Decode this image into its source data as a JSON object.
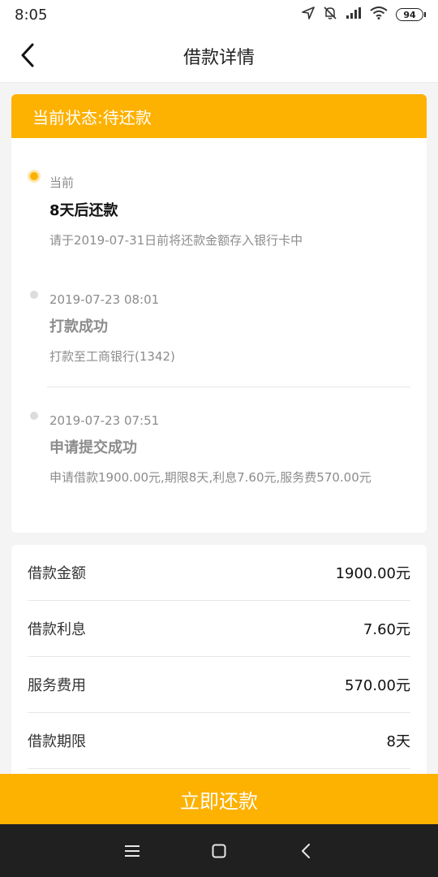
{
  "status_bar": {
    "time": "8:05",
    "battery": "94"
  },
  "header": {
    "title": "借款详情"
  },
  "status_card": {
    "banner": "当前状态:待还款",
    "timeline": [
      {
        "time": "当前",
        "title": "8天后还款",
        "desc": "请于2019-07-31日前将还款金额存入银行卡中",
        "active": true
      },
      {
        "time": "2019-07-23 08:01",
        "title": "打款成功",
        "desc": "打款至工商银行(1342)",
        "active": false
      },
      {
        "time": "2019-07-23 07:51",
        "title": "申请提交成功",
        "desc": "申请借款1900.00元,期限8天,利息7.60元,服务费570.00元",
        "active": false
      }
    ]
  },
  "details": [
    {
      "label": "借款金额",
      "value": "1900.00元"
    },
    {
      "label": "借款利息",
      "value": "7.60元"
    },
    {
      "label": "服务费用",
      "value": "570.00元"
    },
    {
      "label": "借款期限",
      "value": "8天"
    }
  ],
  "actions": {
    "repay_label": "立即还款"
  },
  "colors": {
    "accent": "#fdb100",
    "nav_bg": "#202020"
  },
  "icons": {
    "back": "chevron-left-icon",
    "location": "location-arrow-icon",
    "mute": "bell-off-icon",
    "signal": "signal-icon",
    "wifi": "wifi-icon",
    "battery": "battery-icon",
    "menu": "menu-icon",
    "home": "home-square-icon",
    "nav_back": "nav-back-icon"
  }
}
